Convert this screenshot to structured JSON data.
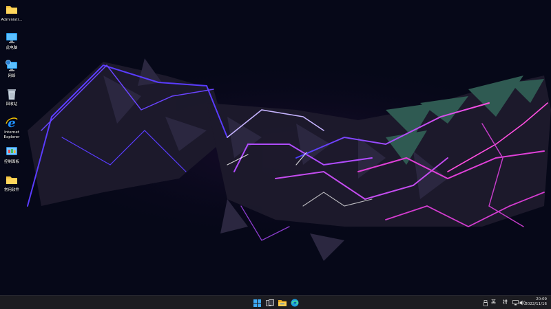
{
  "desktop": {
    "icons": [
      {
        "label": "Administr...",
        "icon": "folder-user-icon"
      },
      {
        "label": "此电脑",
        "icon": "monitor-icon"
      },
      {
        "label": "网络",
        "icon": "network-icon"
      },
      {
        "label": "回收站",
        "icon": "recycle-bin-icon"
      },
      {
        "label": "Internet Explorer",
        "icon": "internet-explorer-icon"
      },
      {
        "label": "控制面板",
        "icon": "control-panel-icon"
      },
      {
        "label": "常用软件",
        "icon": "folder-icon"
      }
    ]
  },
  "taskbar": {
    "apps": [
      {
        "icon": "windows-start-icon"
      },
      {
        "icon": "task-view-icon"
      },
      {
        "icon": "file-explorer-icon"
      },
      {
        "icon": "edge-browser-icon"
      }
    ],
    "tray": {
      "ime_lang": "英",
      "ime_mode": "拼",
      "time": "20:09",
      "date": "2022/11/16"
    }
  },
  "colors": {
    "wallpaper_bg": "#060818",
    "purple": "#7a3cff",
    "magenta": "#e040d8",
    "teal": "#2a6c5c",
    "taskbar": "#1c1c21"
  }
}
